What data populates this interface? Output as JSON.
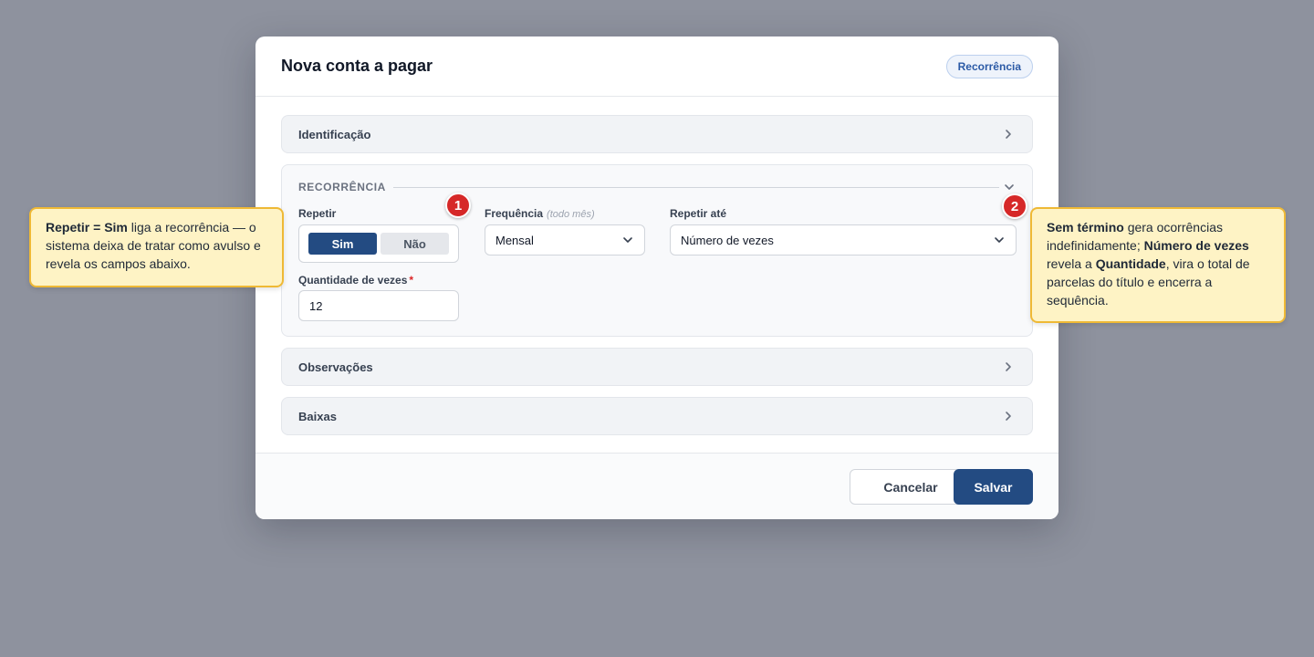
{
  "modal": {
    "title": "Nova conta a pagar",
    "badge": "Recorrência"
  },
  "sections": {
    "identificacao": "Identificação",
    "observacoes": "Observações",
    "baixas": "Baixas"
  },
  "recorrencia": {
    "title": "RECORRÊNCIA",
    "repetir": {
      "label": "Repetir",
      "options": [
        "Sim",
        "Não"
      ],
      "selected": "Sim"
    },
    "frequencia": {
      "label": "Frequência",
      "hint": "(todo mês)",
      "value": "Mensal"
    },
    "repetir_ate": {
      "label": "Repetir até",
      "value": "Número de vezes"
    },
    "quantidade": {
      "label": "Quantidade de vezes",
      "required_mark": "*",
      "value": "12"
    }
  },
  "footer": {
    "cancel": "Cancelar",
    "save": "Salvar"
  },
  "markers": [
    "1",
    "2"
  ],
  "callouts": {
    "left": {
      "bold1": "Repetir = Sim",
      "text1": " liga a recorrência — o sistema deixa de tratar como avulso e revela os campos abaixo."
    },
    "right": {
      "bold1": "Sem término",
      "text1": " gera ocorrências indefinidamente; ",
      "bold2": "Número de vezes",
      "text2": " revela a ",
      "bold3": "Quantidade",
      "text3": ", vira o total de parcelas do título e encerra a sequência."
    }
  },
  "colors": {
    "accent": "#234b82",
    "marker": "#d62828",
    "callout_bg": "#fef3c5",
    "callout_border": "#efb935",
    "backdrop": "#8e929e"
  }
}
